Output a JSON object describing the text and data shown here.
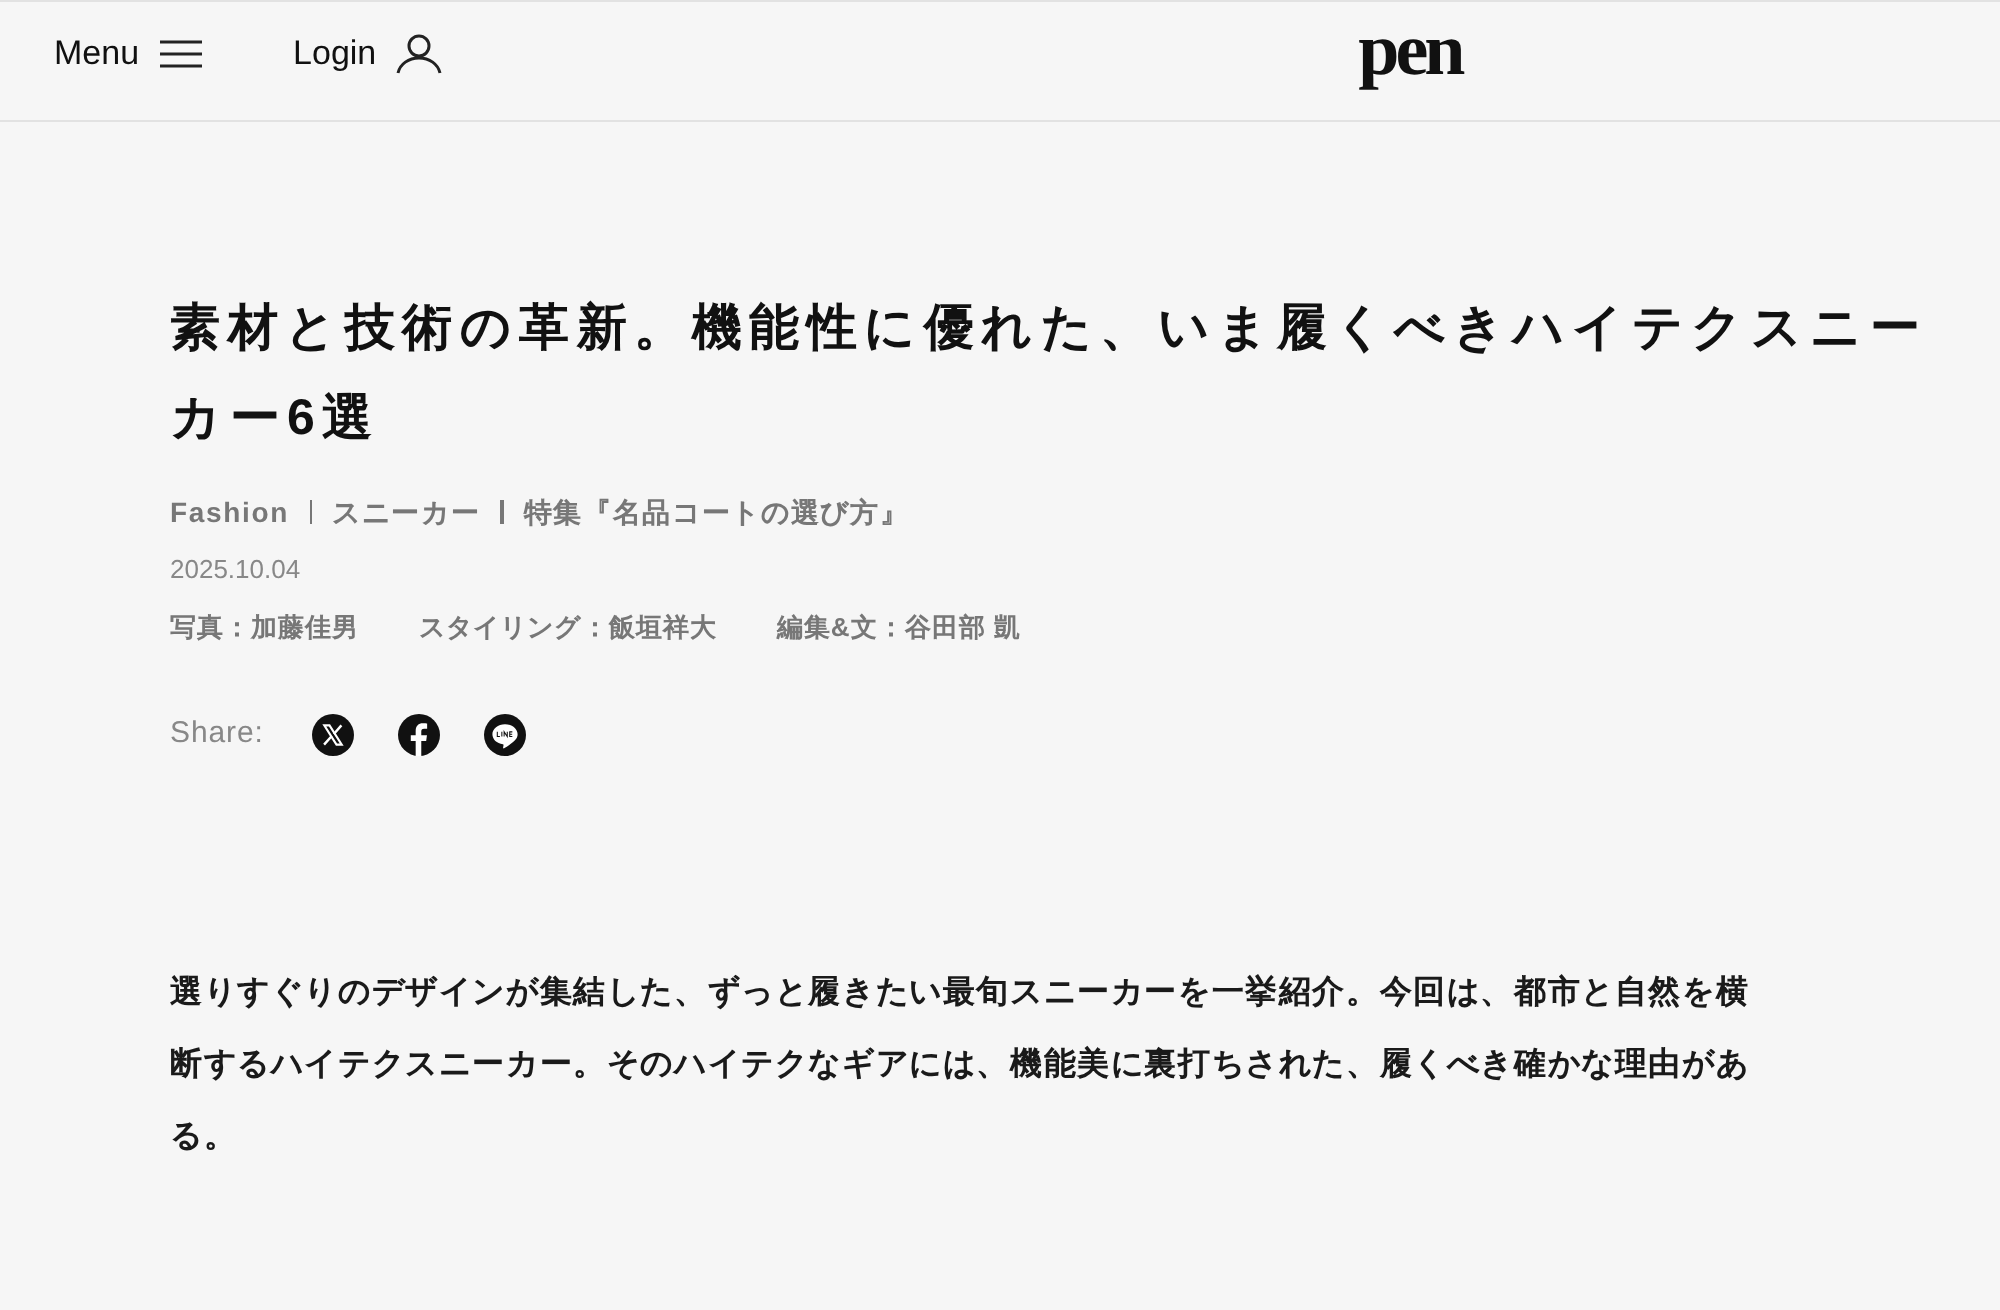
{
  "header": {
    "menu": {
      "label": "Menu"
    },
    "login": {
      "label": "Login"
    },
    "logo": {
      "text": "pen"
    }
  },
  "article": {
    "title": "素材と技術の革新。機能性に優れた、いま履くべきハイテクスニーカー6選",
    "categories": [
      "Fashion",
      "スニーカー",
      "特集『名品コートの選び方』"
    ],
    "date": "2025.10.04",
    "credits": [
      "写真：加藤佳男",
      "スタイリング：飯垣祥大",
      "編集&文：谷田部 凱"
    ],
    "share": {
      "label": "Share:",
      "services": [
        {
          "kind": "x"
        },
        {
          "kind": "facebook"
        },
        {
          "kind": "line"
        }
      ]
    },
    "lead": "選りすぐりのデザインが集結した、ずっと履きたい最旬スニーカーを一挙紹介。今回は、都市と自然を横断するハイテクスニーカー。そのハイテクなギアには、機能美に裏打ちされた、履くべき確かな理由がある。"
  }
}
